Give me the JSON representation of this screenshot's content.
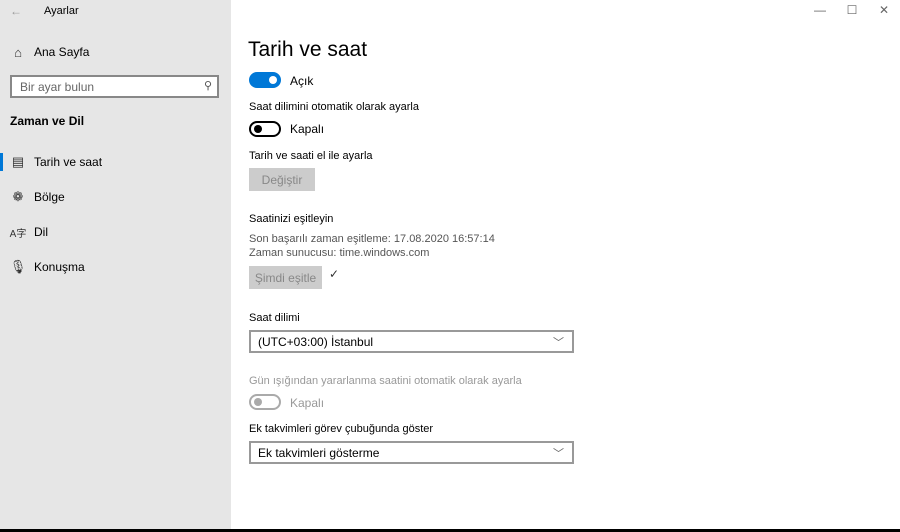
{
  "window": {
    "title": "Ayarlar",
    "back": "←",
    "minimize": "—",
    "maximize": "☐",
    "close": "✕"
  },
  "sidebar": {
    "home": "Ana Sayfa",
    "search_placeholder": "Bir ayar bulun",
    "section": "Zaman ve Dil",
    "items": [
      {
        "label": "Tarih ve saat",
        "icon": "calendar-clock-icon"
      },
      {
        "label": "Bölge",
        "icon": "globe-icon"
      },
      {
        "label": "Dil",
        "icon": "language-icon"
      },
      {
        "label": "Konuşma",
        "icon": "microphone-icon"
      }
    ]
  },
  "main": {
    "title": "Tarih ve saat",
    "auto_time_state": "Açık",
    "auto_tz_label": "Saat dilimini otomatik olarak ayarla",
    "auto_tz_state": "Kapalı",
    "manual_label": "Tarih ve saati el ile ayarla",
    "change_button": "Değiştir",
    "sync_heading": "Saatinizi eşitleyin",
    "last_sync": "Son başarılı zaman eşitleme:  17.08.2020 16:57:14",
    "time_server": "Zaman sunucusu:  time.windows.com",
    "sync_button": "Şimdi eşitle",
    "check": "✓",
    "tz_label": "Saat dilimi",
    "tz_value": "(UTC+03:00) İstanbul",
    "dst_label": "Gün ışığından yararlanma saatini otomatik olarak ayarla",
    "dst_state": "Kapalı",
    "calendar_label": "Ek takvimleri görev çubuğunda göster",
    "calendar_value": "Ek takvimleri gösterme"
  },
  "colors": {
    "accent": "#0078d7",
    "sidebar": "#e6e6e6"
  }
}
